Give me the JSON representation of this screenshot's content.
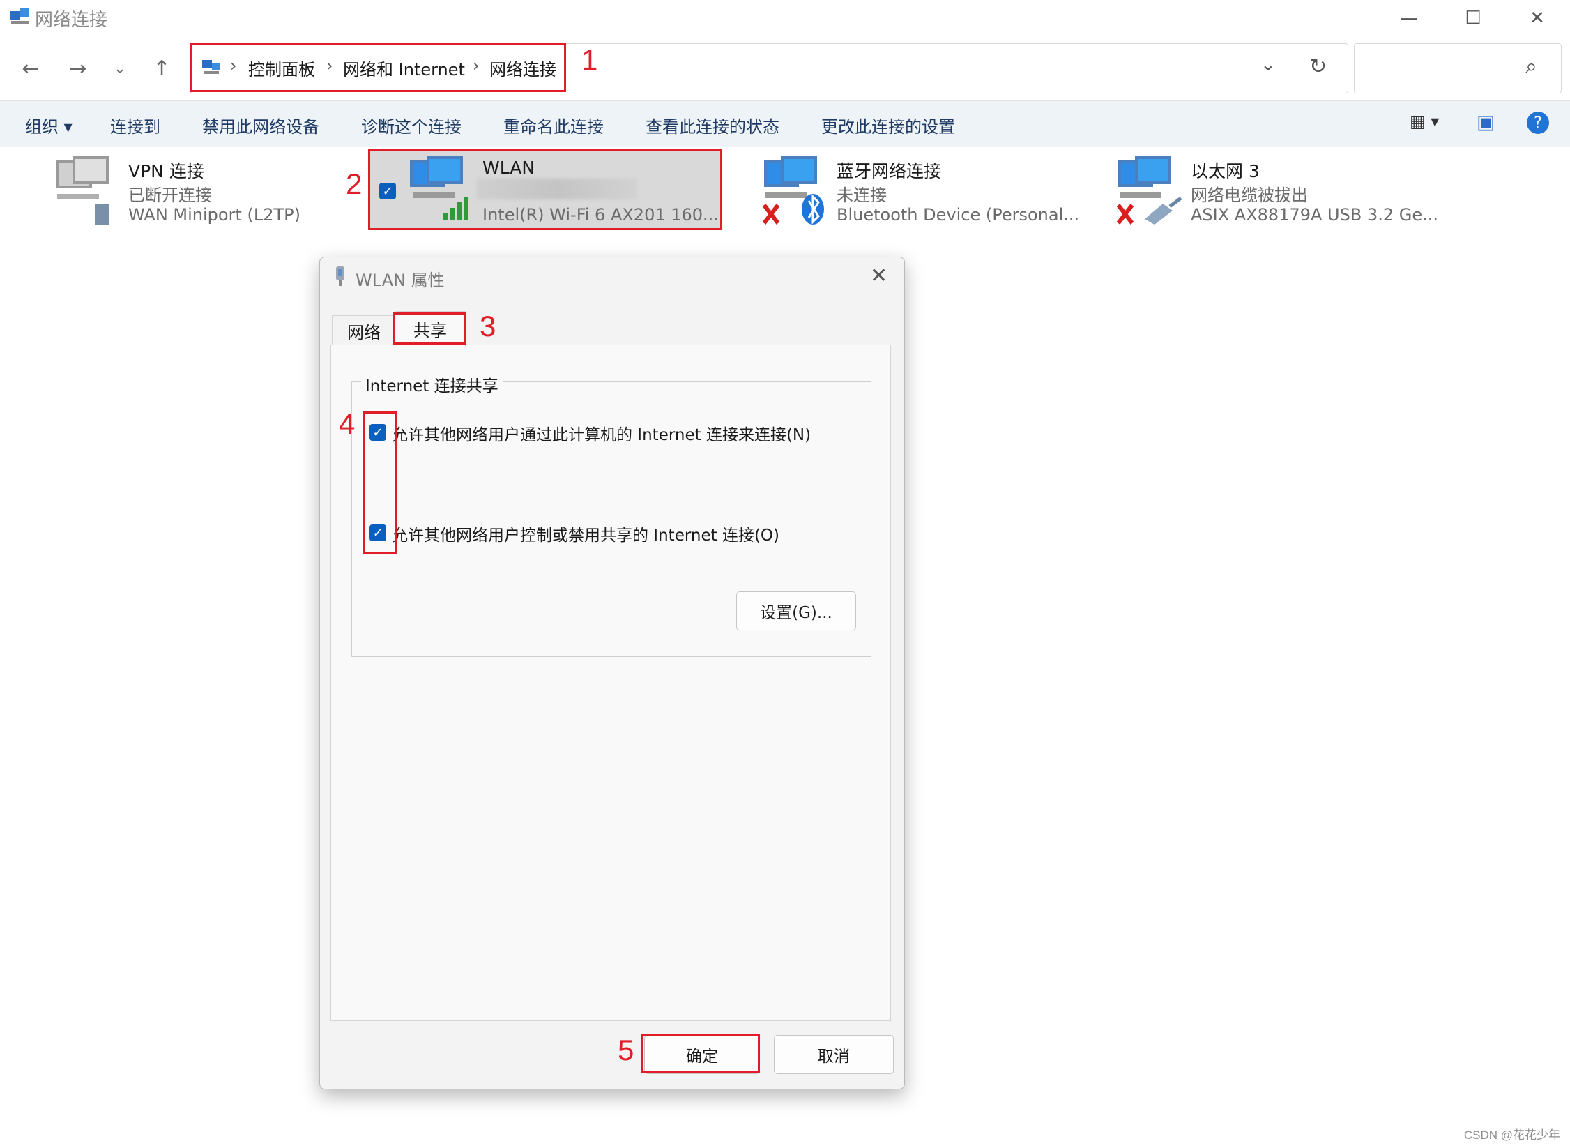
{
  "window": {
    "title": "网络连接",
    "controls": {
      "minimize": "—",
      "maximize": "☐",
      "close": "✕"
    }
  },
  "nav": {
    "back": "←",
    "forward": "→",
    "recent": "⌄",
    "up": "↑",
    "breadcrumb": [
      "控制面板",
      "网络和 Internet",
      "网络连接"
    ],
    "separator": "›",
    "dropdown": "⌄",
    "refresh": "↻",
    "search_icon": "⌕"
  },
  "commands": [
    "组织 ▾",
    "连接到",
    "禁用此网络设备",
    "诊断这个连接",
    "重命名此连接",
    "查看此连接的状态",
    "更改此连接的设置"
  ],
  "view_icons": {
    "layout": "▦ ▾",
    "pane": "▣",
    "help": "?"
  },
  "connections": [
    {
      "name": "VPN 连接",
      "status": "已断开连接",
      "device": "WAN Miniport (L2TP)"
    },
    {
      "name": "WLAN",
      "status": "",
      "device": "Intel(R) Wi-Fi 6 AX201 160..."
    },
    {
      "name": "蓝牙网络连接",
      "status": "未连接",
      "device": "Bluetooth Device (Personal..."
    },
    {
      "name": "以太网 3",
      "status": "网络电缆被拔出",
      "device": "ASIX AX88179A USB 3.2 Ge..."
    }
  ],
  "dialog": {
    "title": "WLAN 属性",
    "close": "✕",
    "tabs": [
      "网络",
      "共享"
    ],
    "group_title": "Internet 连接共享",
    "checkbox1": "允许其他网络用户通过此计算机的 Internet 连接来连接(N)",
    "checkbox2": "允许其他网络用户控制或禁用共享的 Internet 连接(O)",
    "settings_button": "设置(G)...",
    "ok_button": "确定",
    "cancel_button": "取消"
  },
  "annotations": [
    "1",
    "2",
    "3",
    "4",
    "5"
  ],
  "watermark": "CSDN @花花少年",
  "colors": {
    "annotation_red": "#e11d2a",
    "checkbox_blue": "#0a5fbe",
    "command_bar": "#eef3f8"
  }
}
